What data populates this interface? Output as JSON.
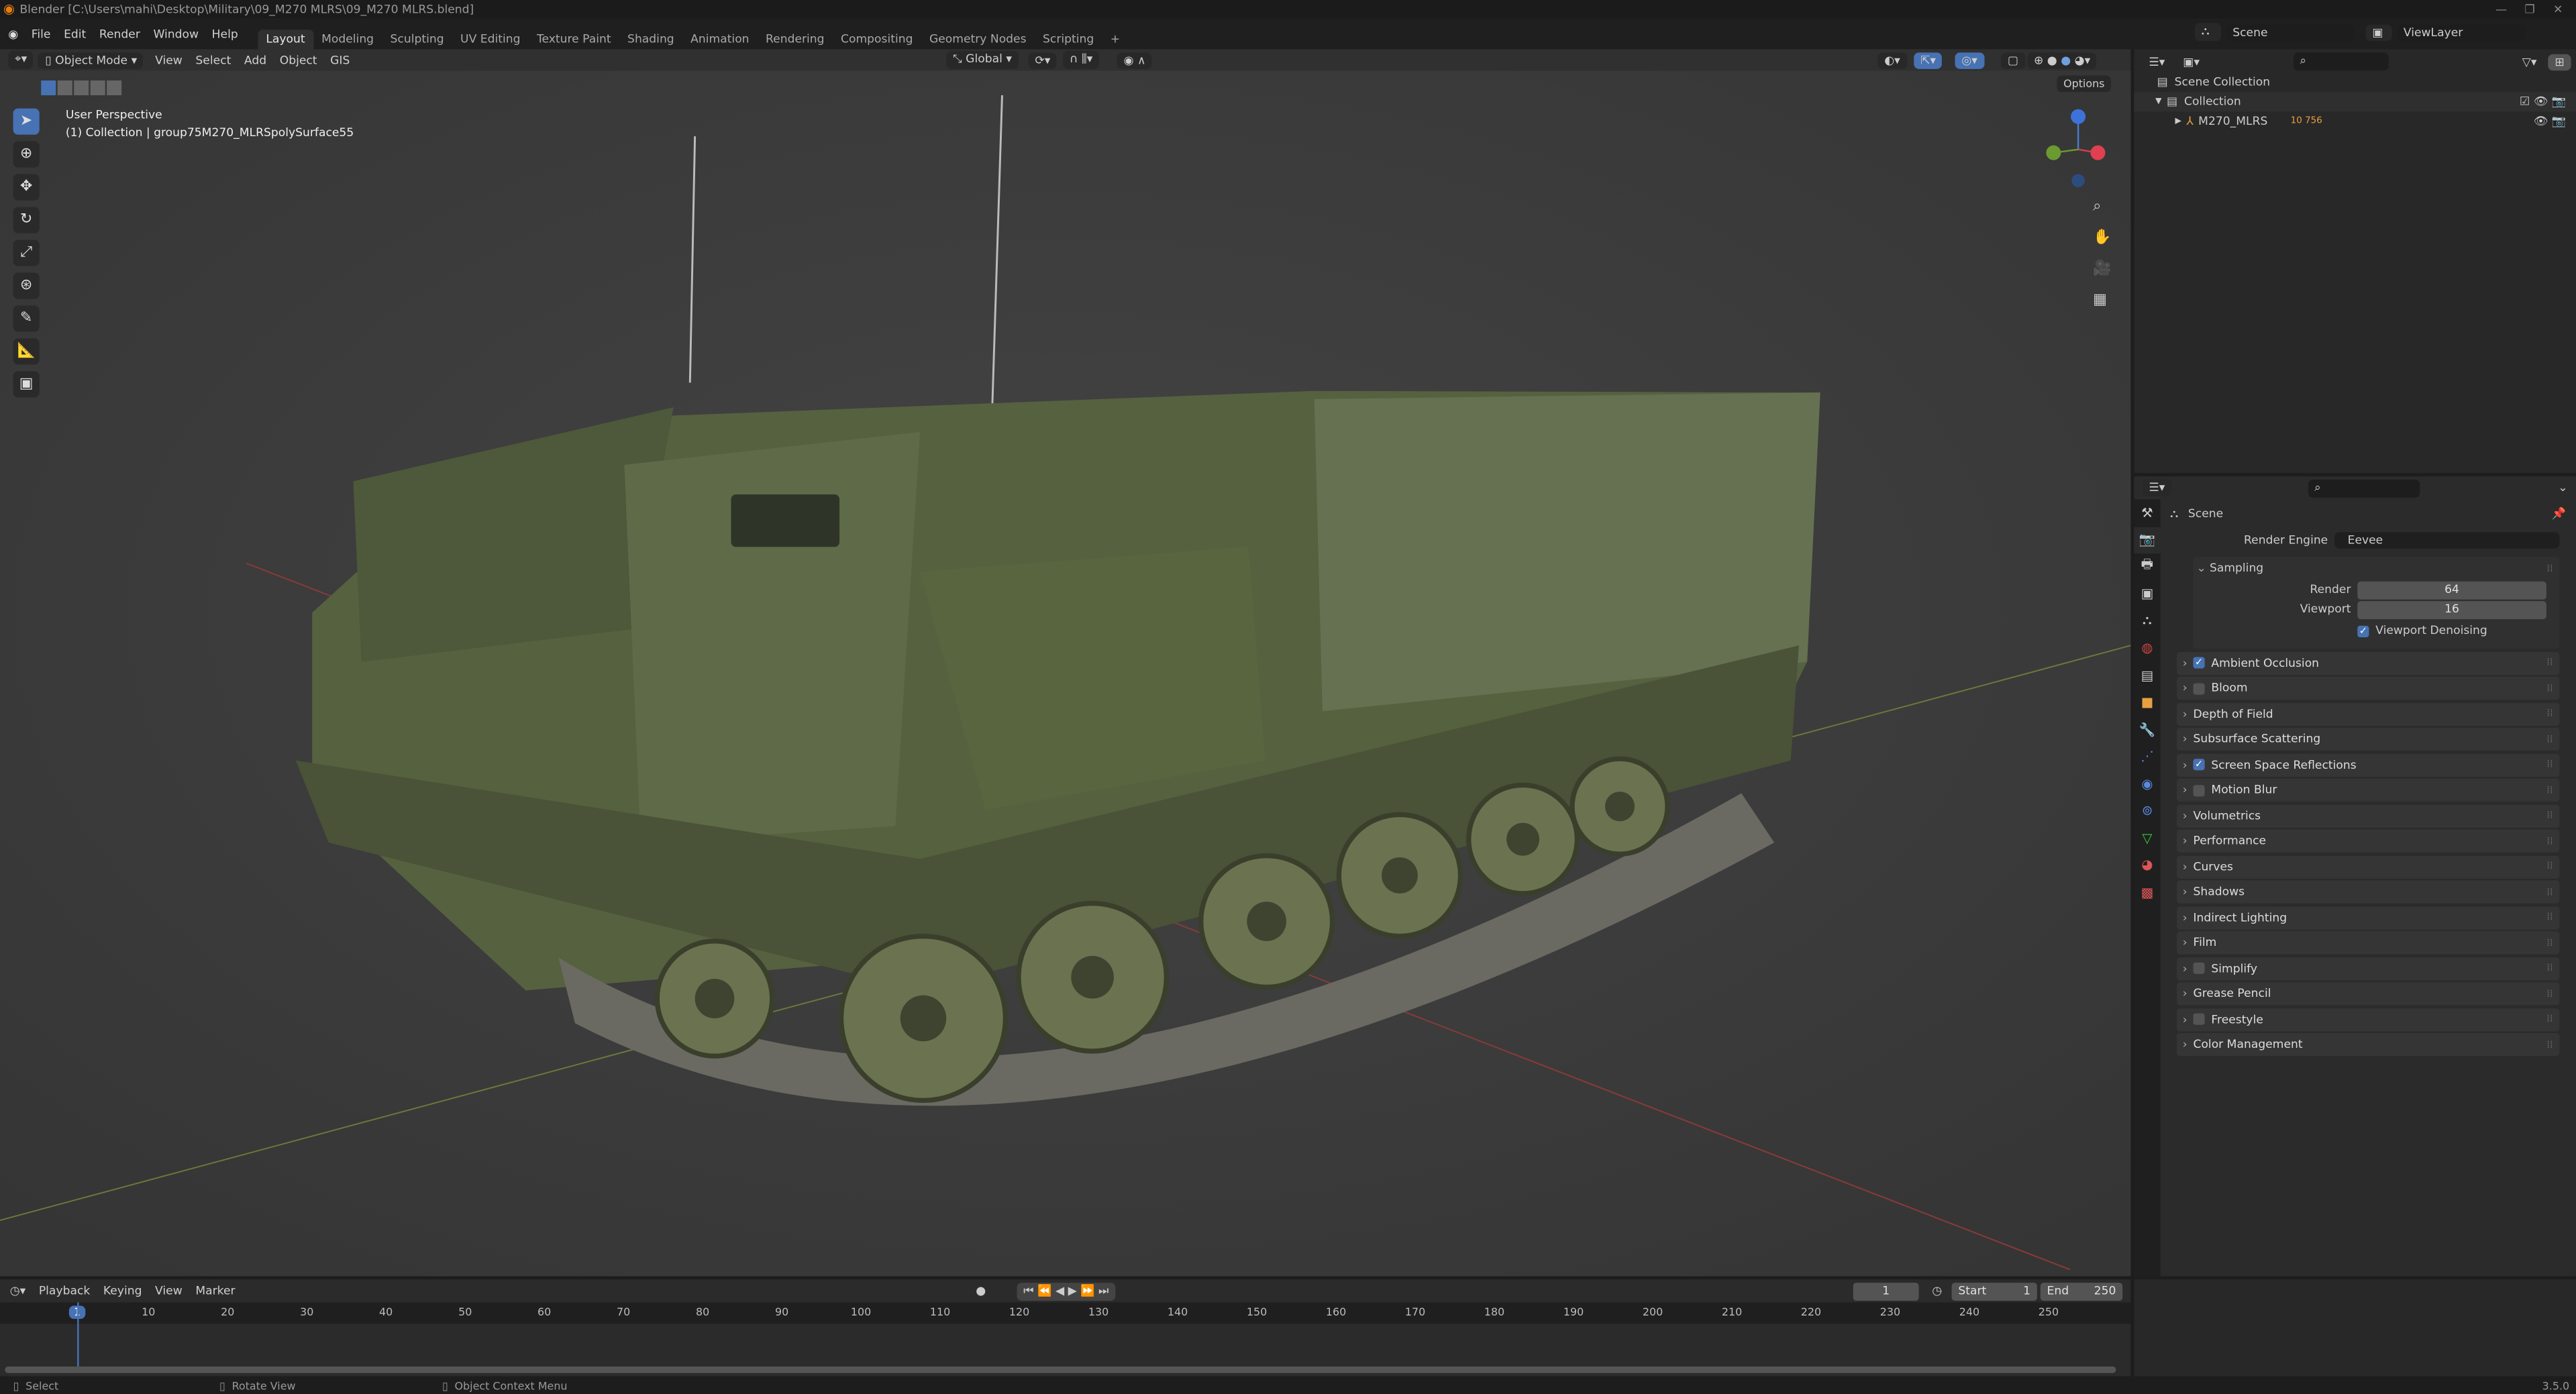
{
  "title": "Blender [C:\\Users\\mahi\\Desktop\\Military\\09_M270 MLRS\\09_M270 MLRS.blend]",
  "menu": [
    "File",
    "Edit",
    "Render",
    "Window",
    "Help"
  ],
  "workspaces": [
    "Layout",
    "Modeling",
    "Sculpting",
    "UV Editing",
    "Texture Paint",
    "Shading",
    "Animation",
    "Rendering",
    "Compositing",
    "Geometry Nodes",
    "Scripting",
    "+"
  ],
  "viewport": {
    "mode": "Object Mode",
    "menus": [
      "View",
      "Select",
      "Add",
      "Object",
      "GIS"
    ],
    "orientation": "Global",
    "options": "Options",
    "perspective": "User Perspective",
    "collection_info": "(1) Collection | group75M270_MLRSpolySurface55"
  },
  "topright": {
    "scene": "Scene",
    "view_layer": "ViewLayer"
  },
  "outliner": {
    "scene_collection": "Scene Collection",
    "collection": "Collection",
    "object": "M270_MLRS",
    "badge": "10 756"
  },
  "properties": {
    "context": "Scene",
    "render_engine_label": "Render Engine",
    "render_engine": "Eevee",
    "sampling": {
      "title": "Sampling",
      "render_label": "Render",
      "render": "64",
      "viewport_label": "Viewport",
      "viewport": "16",
      "denoise": "Viewport Denoising"
    },
    "panels": [
      {
        "label": "Ambient Occlusion",
        "checkbox": true,
        "checked": true
      },
      {
        "label": "Bloom",
        "checkbox": true,
        "checked": false
      },
      {
        "label": "Depth of Field",
        "checkbox": false
      },
      {
        "label": "Subsurface Scattering",
        "checkbox": false
      },
      {
        "label": "Screen Space Reflections",
        "checkbox": true,
        "checked": true
      },
      {
        "label": "Motion Blur",
        "checkbox": true,
        "checked": false
      },
      {
        "label": "Volumetrics",
        "checkbox": false
      },
      {
        "label": "Performance",
        "checkbox": false
      },
      {
        "label": "Curves",
        "checkbox": false
      },
      {
        "label": "Shadows",
        "checkbox": false
      },
      {
        "label": "Indirect Lighting",
        "checkbox": false
      },
      {
        "label": "Film",
        "checkbox": false
      },
      {
        "label": "Simplify",
        "checkbox": true,
        "checked": false
      },
      {
        "label": "Grease Pencil",
        "checkbox": false
      },
      {
        "label": "Freestyle",
        "checkbox": true,
        "checked": false
      },
      {
        "label": "Color Management",
        "checkbox": false
      }
    ]
  },
  "timeline": {
    "menus": [
      "Playback",
      "Keying",
      "View",
      "Marker"
    ],
    "current_frame": "1",
    "start_label": "Start",
    "start": "1",
    "end_label": "End",
    "end": "250",
    "ticks": [
      "1",
      "10",
      "20",
      "30",
      "40",
      "50",
      "60",
      "70",
      "80",
      "90",
      "100",
      "110",
      "120",
      "130",
      "140",
      "150",
      "160",
      "170",
      "180",
      "190",
      "200",
      "210",
      "220",
      "230",
      "240",
      "250"
    ]
  },
  "status": {
    "items": [
      "Select",
      "Rotate View",
      "Object Context Menu"
    ],
    "version": "3.5.0"
  },
  "colors": {
    "accent": "#4772b3",
    "object": "#e8a040"
  }
}
